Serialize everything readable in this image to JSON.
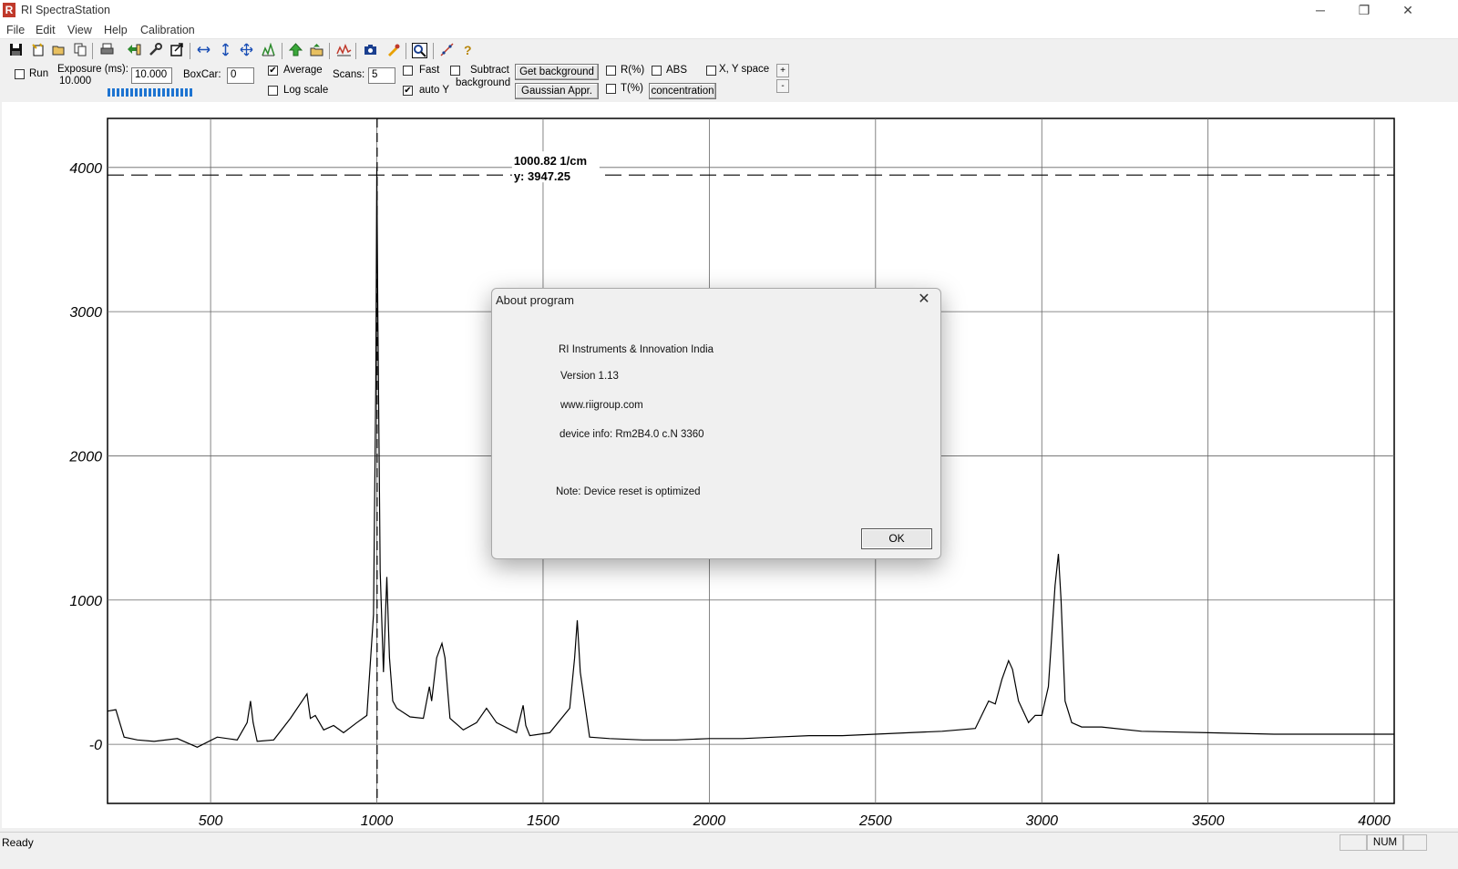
{
  "window": {
    "title": "RI SpectraStation",
    "app_icon_letter": "R",
    "minimize": "─",
    "restore": "❐",
    "close": "✕"
  },
  "menu": [
    "File",
    "Edit",
    "View",
    "Help",
    "Calibration"
  ],
  "toolbar_icons": [
    "save-icon",
    "new-icon",
    "open-icon",
    "copy-icon",
    "print-icon",
    "import-icon",
    "settings-wrench-icon",
    "export-icon",
    "scale-horizontal-icon",
    "scale-vertical-icon",
    "scale-both-icon",
    "peaks-icon",
    "arrow-up-icon",
    "folder-up-icon",
    "spectrum-icon",
    "camera-icon",
    "marker-icon",
    "zoom-icon",
    "line-tool-icon",
    "help-icon"
  ],
  "controls": {
    "run_label": "Run",
    "exposure_label": "Exposure (ms):",
    "exposure_value": "10.000",
    "exposure_input": "10.000",
    "boxcar_label": "BoxCar:",
    "boxcar_input": "0",
    "average_label": "Average",
    "average_checked": "✔",
    "log_scale_label": "Log scale",
    "scans_label": "Scans:",
    "scans_input": "5",
    "fast_label": "Fast",
    "auto_y_label": "auto Y",
    "auto_y_checked": "✔",
    "subtract_label_1": "Subtract",
    "subtract_label_2": "background",
    "get_background": "Get background",
    "gaussian": "Gaussian Appr.",
    "r_percent": "R(%)",
    "t_percent": "T(%)",
    "abs": "ABS",
    "concentration": "concentration",
    "xy_space": "X, Y space",
    "plus": "+",
    "minus": "-"
  },
  "chart_data": {
    "type": "line",
    "xlim": [
      190,
      4060
    ],
    "ylim": [
      -410,
      4340
    ],
    "x_ticks": [
      500,
      1000,
      1500,
      2000,
      2500,
      3000,
      3500,
      4000
    ],
    "x_tick_labels": [
      "500",
      "1000",
      "1500",
      "2000",
      "2500",
      "3000",
      "3500",
      "4000"
    ],
    "y_ticks": [
      0,
      1000,
      2000,
      3000,
      4000
    ],
    "y_tick_labels": [
      "-0",
      "1000",
      "2000",
      "3000",
      "4000"
    ],
    "grid": true,
    "cursor": {
      "x": 1000.82,
      "y": 3947.25,
      "label_x": "1000.82 1/cm",
      "label_y": "y: 3947.25"
    },
    "series": [
      {
        "x": [
          190,
          215,
          240,
          280,
          330,
          400,
          460,
          520,
          580,
          610,
          620,
          628,
          640,
          690,
          740,
          790,
          800,
          815,
          840,
          870,
          900,
          940,
          970,
          990,
          997,
          1000,
          1003,
          1010,
          1020,
          1030,
          1038,
          1048,
          1060,
          1100,
          1140,
          1158,
          1165,
          1180,
          1196,
          1205,
          1220,
          1260,
          1300,
          1330,
          1360,
          1420,
          1440,
          1448,
          1460,
          1520,
          1580,
          1595,
          1603,
          1612,
          1640,
          1700,
          1800,
          1900,
          2000,
          2100,
          2200,
          2300,
          2400,
          2500,
          2600,
          2700,
          2800,
          2840,
          2860,
          2880,
          2900,
          2912,
          2930,
          2960,
          2980,
          3000,
          3020,
          3040,
          3050,
          3058,
          3070,
          3090,
          3120,
          3180,
          3300,
          3500,
          3700,
          3900,
          4060
        ],
        "y": [
          230,
          240,
          50,
          30,
          20,
          40,
          -20,
          50,
          30,
          150,
          300,
          150,
          20,
          30,
          180,
          350,
          180,
          200,
          100,
          130,
          80,
          150,
          200,
          900,
          2500,
          4000,
          3000,
          1200,
          500,
          1160,
          600,
          300,
          250,
          190,
          180,
          400,
          300,
          600,
          700,
          600,
          180,
          100,
          150,
          250,
          150,
          80,
          270,
          130,
          60,
          80,
          250,
          600,
          860,
          500,
          50,
          40,
          30,
          30,
          40,
          40,
          50,
          60,
          60,
          70,
          80,
          90,
          110,
          300,
          280,
          450,
          580,
          520,
          300,
          150,
          200,
          200,
          400,
          1100,
          1320,
          1000,
          300,
          150,
          120,
          120,
          90,
          80,
          70,
          70,
          70
        ]
      }
    ]
  },
  "dialog": {
    "title": "About program",
    "close": "✕",
    "company": "RI Instruments & Innovation India",
    "version": "Version 1.13",
    "website": "www.riigroup.com",
    "device_info": "device info: Rm2B4.0 c.N 3360",
    "note": "Note: Device reset is optimized",
    "ok": "OK"
  },
  "status": {
    "text": "Ready",
    "num": "NUM"
  }
}
